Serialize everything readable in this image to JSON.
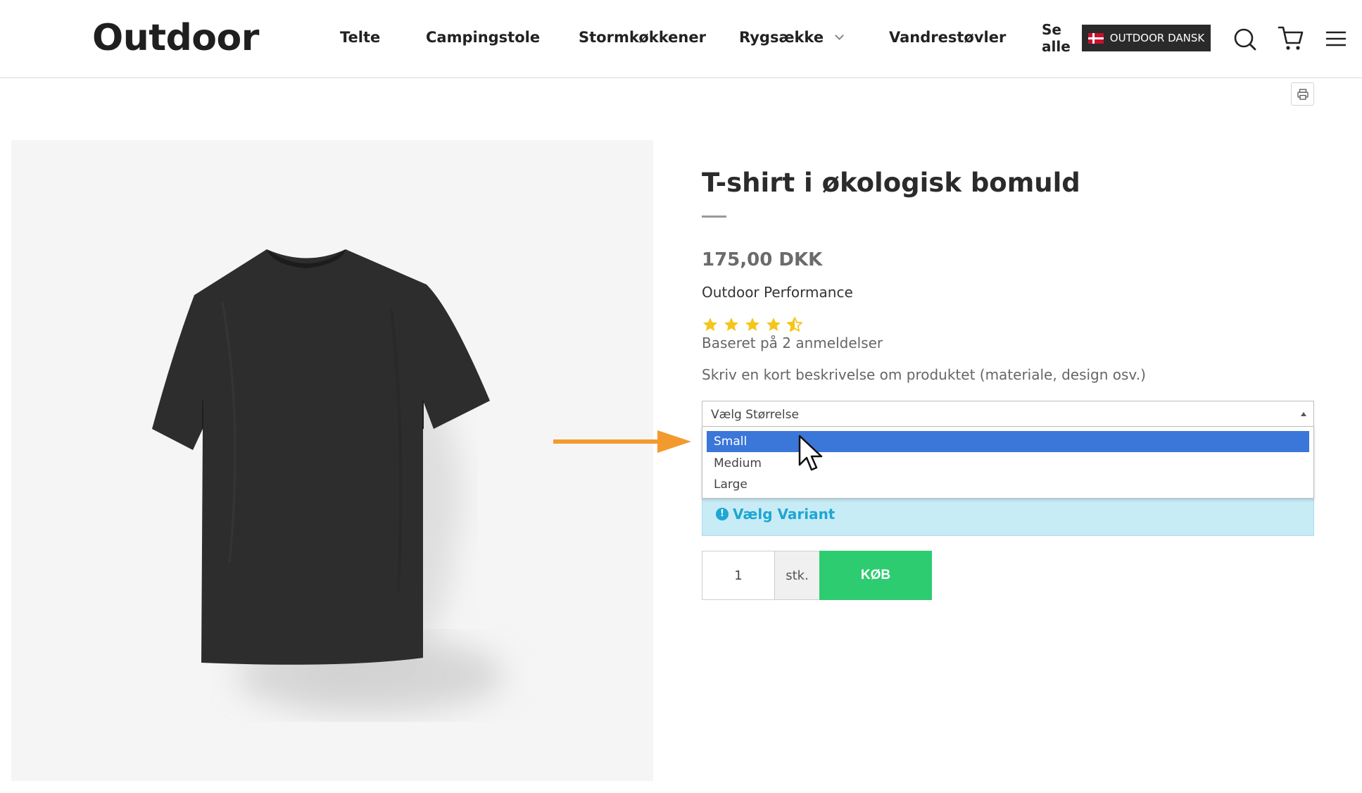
{
  "header": {
    "logo": "Outdoor",
    "nav": [
      {
        "label": "Telte"
      },
      {
        "label": "Campingstole"
      },
      {
        "label": "Stormkøkkener"
      },
      {
        "label": "Rygsække"
      },
      {
        "label": "Vandrestøvler"
      }
    ],
    "see_all_line1": "Se",
    "see_all_line2": "alle",
    "language_label": "OUTDOOR DANSK",
    "icons": [
      "search-icon",
      "cart-icon",
      "menu-icon"
    ]
  },
  "toolbar": {
    "print_icon": "print-icon"
  },
  "product": {
    "image_icon": "black-tshirt",
    "title": "T-shirt i økologisk bomuld",
    "price": "175,00 DKK",
    "brand": "Outdoor Performance",
    "rating": 4.5,
    "rating_max": 5,
    "reviews": "Baseret på 2 anmeldelser",
    "description": "Skriv en kort beskrivelse om produktet (materiale, design osv.)",
    "size_select": {
      "placeholder": "Vælg Størrelse",
      "options": [
        "Small",
        "Medium",
        "Large"
      ],
      "highlighted": "Small"
    },
    "variant_alert": "Vælg Variant",
    "quantity": "1",
    "quantity_unit": "stk.",
    "buy_label": "KØB"
  },
  "colors": {
    "accent_arrow": "#f39a2e",
    "buy_green": "#2dcc70",
    "select_highlight": "#3b77d8",
    "alert_bg": "#c7ecf6",
    "alert_text": "#1fa6d2",
    "star": "#f5c518"
  }
}
